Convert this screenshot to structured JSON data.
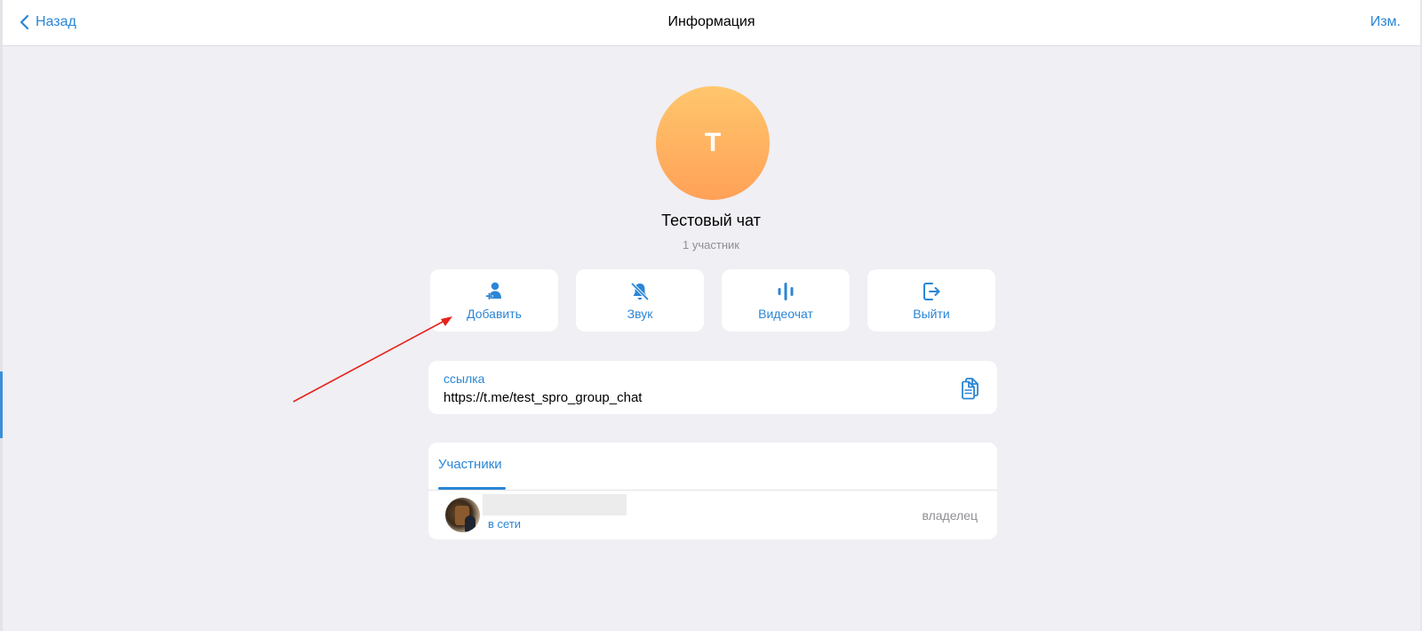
{
  "nav": {
    "back_label": "Назад",
    "title": "Информация",
    "edit_label": "Изм."
  },
  "chat": {
    "avatar_letter": "T",
    "name": "Тестовый чат",
    "subtitle": "1 участник"
  },
  "actions": [
    {
      "label": "Добавить",
      "icon": "add-user-icon"
    },
    {
      "label": "Звук",
      "icon": "muted-bell-icon"
    },
    {
      "label": "Видеочат",
      "icon": "voice-waves-icon"
    },
    {
      "label": "Выйти",
      "icon": "logout-icon"
    }
  ],
  "link": {
    "caption": "ссылка",
    "url": "https://t.me/test_spro_group_chat",
    "copy_icon": "copy-icon"
  },
  "members": {
    "tab_label": "Участники",
    "rows": [
      {
        "name": "",
        "status": "в сети",
        "role": "владелец"
      }
    ]
  },
  "colors": {
    "accent": "#2a86d6",
    "background": "#efeff4",
    "avatar_gradient_top": "#ffc66d",
    "avatar_gradient_bottom": "#ffa157",
    "annotation_arrow": "#e8231b"
  }
}
